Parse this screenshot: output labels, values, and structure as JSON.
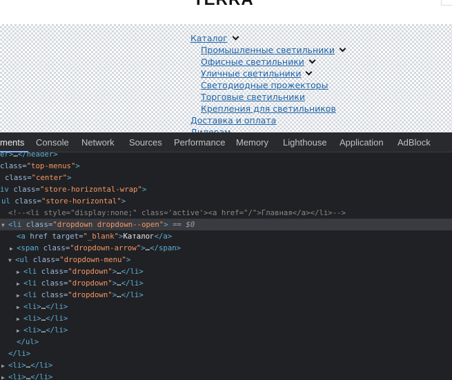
{
  "page": {
    "logo": "TERRA",
    "menu": {
      "catalog": "Каталог",
      "submenu": [
        {
          "label": "Промышленные светильники",
          "has_arrow": true
        },
        {
          "label": "Офисные светильники",
          "has_arrow": true
        },
        {
          "label": "Уличные светильники",
          "has_arrow": true
        },
        {
          "label": "Светодиодные прожекторы",
          "has_arrow": false
        },
        {
          "label": "Торговые светильники",
          "has_arrow": false
        },
        {
          "label": "Крепления для светильников",
          "has_arrow": false
        }
      ],
      "delivery": "Доставка и оплата",
      "dealers": "Дилерам"
    }
  },
  "devtools": {
    "tabs": [
      "ments",
      "Console",
      "Network",
      "Sources",
      "Performance",
      "Memory",
      "Lighthouse",
      "Application",
      "AdBlock"
    ],
    "active_tab": "ments",
    "tree": {
      "l0": {
        "a": "er>",
        "b": "…",
        "c": "</header>"
      },
      "l1": {
        "a": "class",
        "b": "\"top-menus\"",
        "c": ">"
      },
      "l2": {
        "a": "class",
        "b": "\"center\"",
        "c": ">"
      },
      "l3": {
        "a": "iv",
        "b": "class",
        "c": "\"store-horizontal-wrap\"",
        "d": ">"
      },
      "l4": {
        "a": "ul",
        "b": "class",
        "c": "\"store-horizontal\"",
        "d": ">"
      },
      "l5": {
        "a": "<!--<li style=\"display:none;\" class='active'><a href=\"/\">Главная</a></li>-->"
      },
      "l6": {
        "a": "▼",
        "b": "<li",
        "c": "class",
        "d": "\"dropdown dropdown--open\"",
        "e": ">",
        "f": "== $0"
      },
      "l7": {
        "a": "<a",
        "b": "href",
        "c": "target",
        "d": "\"_blank\"",
        "e": ">",
        "f": "Каталог",
        "g": "</a>"
      },
      "l8": {
        "a": "▶",
        "b": "<span",
        "c": "class",
        "d": "\"dropdown-arrow\"",
        "e": ">",
        "f": "…",
        "g": "</span>"
      },
      "l9": {
        "a": "▼",
        "b": "<ul",
        "c": "class",
        "d": "\"dropdown-menu\"",
        "e": ">"
      },
      "l10": {
        "a": "▶",
        "b": "<li",
        "c": "class",
        "d": "\"dropdown\"",
        "e": ">",
        "f": "…",
        "g": "</li>"
      },
      "l11": {
        "a": "▶",
        "b": "<li",
        "c": "class",
        "d": "\"dropdown\"",
        "e": ">",
        "f": "…",
        "g": "</li>"
      },
      "l12": {
        "a": "▶",
        "b": "<li",
        "c": "class",
        "d": "\"dropdown\"",
        "e": ">",
        "f": "…",
        "g": "</li>"
      },
      "l13": {
        "a": "▶",
        "b": "<li>",
        "c": "…",
        "d": "</li>"
      },
      "l14": {
        "a": "▶",
        "b": "<li>",
        "c": "…",
        "d": "</li>"
      },
      "l15": {
        "a": "▶",
        "b": "<li>",
        "c": "…",
        "d": "</li>"
      },
      "l16": {
        "a": "</ul>"
      },
      "l17": {
        "a": "</li>"
      },
      "l18": {
        "a": "▶",
        "b": "<li>",
        "c": "…",
        "d": "</li>"
      },
      "l19": {
        "a": "▶",
        "b": "<li>",
        "c": "…",
        "d": "</li>"
      }
    }
  },
  "colors": {
    "devtools_bg": "#202124",
    "tab_bar_bg": "#292a2d",
    "selected_row": "#393b40",
    "tag": "#5db0d7",
    "attr_name": "#9bbbdc",
    "attr_value": "#f29766",
    "link": "#1f65a8"
  }
}
